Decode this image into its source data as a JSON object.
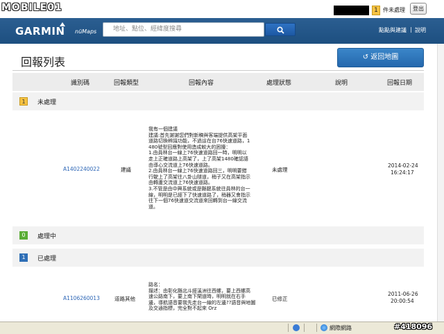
{
  "topbar": {
    "site_logo": "MOBILE01",
    "pending_count": "1",
    "pending_label": "件未處理",
    "logout_label": "登出"
  },
  "header": {
    "brand": "GARMIN",
    "product": "nüMaps",
    "search_placeholder": "地址、點位、經緯度搜尋",
    "nav": [
      "點點與建議",
      "說明"
    ]
  },
  "page": {
    "title": "回報列表",
    "back_button": "返回地圖"
  },
  "table": {
    "columns": [
      "識別碼",
      "回報類型",
      "回報內容",
      "處理狀態",
      "說明",
      "回報日期"
    ],
    "groups": [
      {
        "count": "1",
        "label": "未處理",
        "rows": [
          {
            "id": "A1402240022",
            "type": "建議",
            "content": [
              "我有一個建議",
              "建議:首先謝謝您們對新稿與客端提供高架平面",
              "道路切換辨識功能，不過這在台76快速道路，1",
              "480號型回應對使用造成較大的困擾：",
              "1.由員林台一線上76快速道路回一時，明明以",
              "走上正確道路上高架了，上了高架1480確認語",
              "由導心交流道上76快速道路。",
              "2.由員林台一線上76快速道路回三，明明要錯",
              "行駛上了高架往八卦山隧道，稍子又在高架指示",
              "由轉蘆交流道上76快速道路。",
              "3.不管是由中興系統或是縣腮系統往員林的台一",
              "線，明明是已經下了快速道路了，稍器又會指示",
              "往下一個76快速道交流道來回轉到台一線交流",
              "道。"
            ],
            "status": "未處理",
            "note": "",
            "date": "2014-02-24",
            "time": "16:24:17"
          }
        ]
      },
      {
        "count": "0",
        "label": "處理中",
        "rows": []
      },
      {
        "count": "1",
        "label": "已處理",
        "rows": [
          {
            "id": "A1106260013",
            "type": "道路其他",
            "content": [
              "路名：",
              "描述：由彰化縣北斗經溪洲往西螺，要上西螺高",
              "速公路南下，要上南下閘道時，明明就在右手",
              "邊，導航語音要我先走台一線的左邊??語音與地圖",
              "及交通指標，完全對不起來 Orz"
            ],
            "status": "已修正",
            "note": "",
            "date": "2011-06-26",
            "time": "20:00:54"
          }
        ]
      }
    ]
  },
  "statusbar": {
    "zone": "網際網路"
  },
  "watermark": "#418096"
}
